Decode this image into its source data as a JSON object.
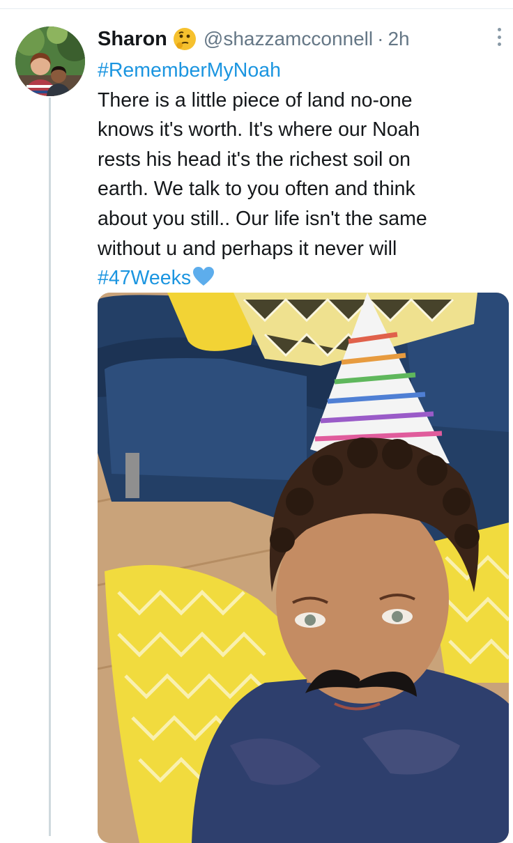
{
  "tweet": {
    "author_name": "Sharon",
    "author_emoji": "thinking-face-emoji",
    "handle": "@shazzamcconnell",
    "separator": "·",
    "timestamp": "2h",
    "text_lines": [
      "#RememberMyNoah",
      "There is a little piece of land no-one",
      "knows it's worth. It's where our Noah",
      "rests his head it's the richest soil on",
      "earth. We talk to you often and think",
      "about you still.. Our life isn't the same",
      "without u and perhaps it never will",
      "#47Weeks"
    ],
    "trailing_emoji": "blue-heart-emoji",
    "media": {
      "kind": "photo",
      "icon": "photo-of-boy-with-party-hat-and-moustache"
    }
  },
  "colors": {
    "text": "#14171a",
    "secondary": "#657786",
    "link": "#1b95e0",
    "thread_line": "#cfd9de",
    "divider": "#e6ecf0"
  },
  "icons": {
    "more_menu": "vertical-ellipsis-icon"
  }
}
